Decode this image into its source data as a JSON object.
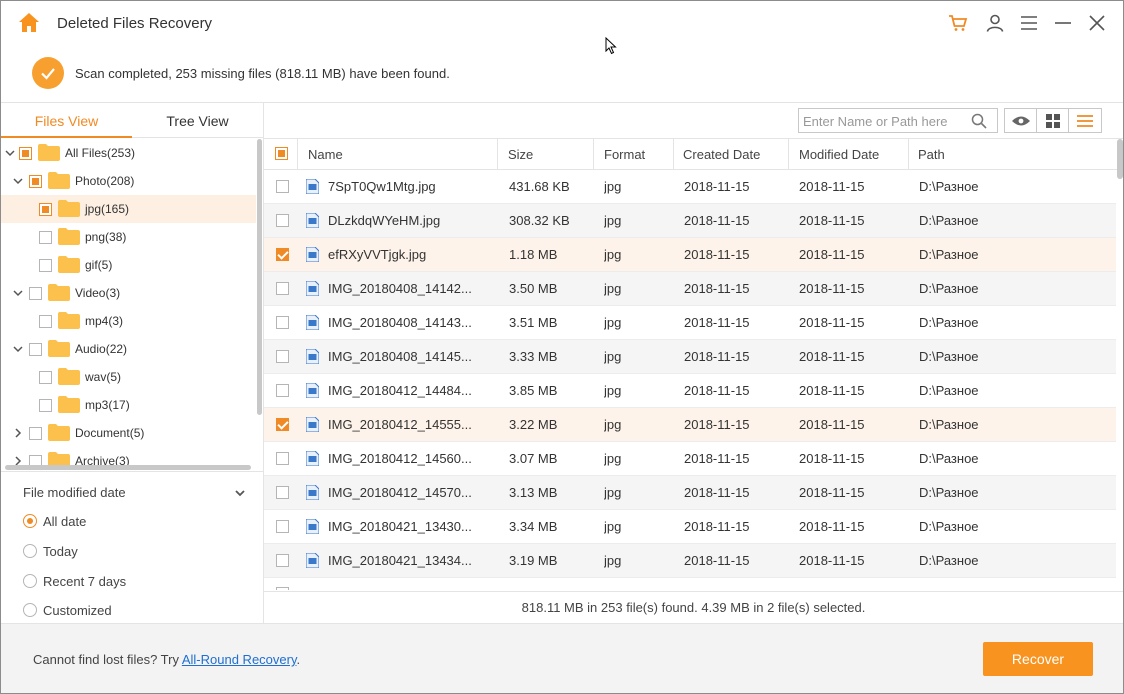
{
  "app": {
    "title": "Deleted Files Recovery"
  },
  "icons": {
    "home": "home-icon",
    "cart": "cart-icon",
    "user": "user-icon",
    "menu": "menu-icon",
    "minimize": "minimize-icon",
    "close": "close-icon"
  },
  "colors": {
    "accent": "#f08a24",
    "button": "#f7931e",
    "link": "#1e6fd1",
    "check": "#f7a030"
  },
  "status": {
    "message": "Scan completed, 253 missing files (818.11 MB) have been found."
  },
  "view_tabs": [
    {
      "label": "Files View",
      "active": true
    },
    {
      "label": "Tree View",
      "active": false
    }
  ],
  "tree": [
    {
      "label": "All Files(253)",
      "expanded": true,
      "state": "partial"
    },
    {
      "label": "Photo(208)",
      "expanded": true,
      "state": "partial"
    },
    {
      "label": "jpg(165)",
      "state": "partial",
      "selected": true
    },
    {
      "label": "png(38)",
      "state": "unchecked"
    },
    {
      "label": "gif(5)",
      "state": "unchecked"
    },
    {
      "label": "Video(3)",
      "expanded": true,
      "state": "unchecked"
    },
    {
      "label": "mp4(3)",
      "state": "unchecked"
    },
    {
      "label": "Audio(22)",
      "expanded": true,
      "state": "unchecked"
    },
    {
      "label": "wav(5)",
      "state": "unchecked"
    },
    {
      "label": "mp3(17)",
      "state": "unchecked"
    },
    {
      "label": "Document(5)",
      "expanded": false,
      "state": "unchecked"
    },
    {
      "label": "Archive(3)",
      "expanded": false,
      "state": "unchecked"
    }
  ],
  "filter": {
    "title": "File modified date",
    "options": [
      {
        "label": "All date",
        "selected": true
      },
      {
        "label": "Today",
        "selected": false
      },
      {
        "label": "Recent 7 days",
        "selected": false
      },
      {
        "label": "Customized",
        "selected": false
      }
    ]
  },
  "search": {
    "placeholder": "Enter Name or Path here",
    "value": ""
  },
  "table": {
    "columns": [
      "Name",
      "Size",
      "Format",
      "Created Date",
      "Modified Date",
      "Path"
    ],
    "rows": [
      {
        "name": "7SpT0Qw1Mtg.jpg",
        "size": "431.68 KB",
        "format": "jpg",
        "created": "2018-11-15",
        "modified": "2018-11-15",
        "path": "D:\\Разное",
        "checked": false
      },
      {
        "name": "DLzkdqWYeHM.jpg",
        "size": "308.32 KB",
        "format": "jpg",
        "created": "2018-11-15",
        "modified": "2018-11-15",
        "path": "D:\\Разное",
        "checked": false
      },
      {
        "name": "efRXyVVTjgk.jpg",
        "size": "1.18 MB",
        "format": "jpg",
        "created": "2018-11-15",
        "modified": "2018-11-15",
        "path": "D:\\Разное",
        "checked": true
      },
      {
        "name": "IMG_20180408_14142...",
        "size": "3.50 MB",
        "format": "jpg",
        "created": "2018-11-15",
        "modified": "2018-11-15",
        "path": "D:\\Разное",
        "checked": false
      },
      {
        "name": "IMG_20180408_14143...",
        "size": "3.51 MB",
        "format": "jpg",
        "created": "2018-11-15",
        "modified": "2018-11-15",
        "path": "D:\\Разное",
        "checked": false
      },
      {
        "name": "IMG_20180408_14145...",
        "size": "3.33 MB",
        "format": "jpg",
        "created": "2018-11-15",
        "modified": "2018-11-15",
        "path": "D:\\Разное",
        "checked": false
      },
      {
        "name": "IMG_20180412_14484...",
        "size": "3.85 MB",
        "format": "jpg",
        "created": "2018-11-15",
        "modified": "2018-11-15",
        "path": "D:\\Разное",
        "checked": false
      },
      {
        "name": "IMG_20180412_14555...",
        "size": "3.22 MB",
        "format": "jpg",
        "created": "2018-11-15",
        "modified": "2018-11-15",
        "path": "D:\\Разное",
        "checked": true
      },
      {
        "name": "IMG_20180412_14560...",
        "size": "3.07 MB",
        "format": "jpg",
        "created": "2018-11-15",
        "modified": "2018-11-15",
        "path": "D:\\Разное",
        "checked": false
      },
      {
        "name": "IMG_20180412_14570...",
        "size": "3.13 MB",
        "format": "jpg",
        "created": "2018-11-15",
        "modified": "2018-11-15",
        "path": "D:\\Разное",
        "checked": false
      },
      {
        "name": "IMG_20180421_13430...",
        "size": "3.34 MB",
        "format": "jpg",
        "created": "2018-11-15",
        "modified": "2018-11-15",
        "path": "D:\\Разное",
        "checked": false
      },
      {
        "name": "IMG_20180421_13434...",
        "size": "3.19 MB",
        "format": "jpg",
        "created": "2018-11-15",
        "modified": "2018-11-15",
        "path": "D:\\Разное",
        "checked": false
      }
    ]
  },
  "summary": "818.11 MB in 253 file(s) found. 4.39 MB in 2 file(s) selected.",
  "footer": {
    "prefix": "Cannot find lost files? Try ",
    "link": "All-Round Recovery",
    "suffix": ".",
    "recover_label": "Recover"
  }
}
